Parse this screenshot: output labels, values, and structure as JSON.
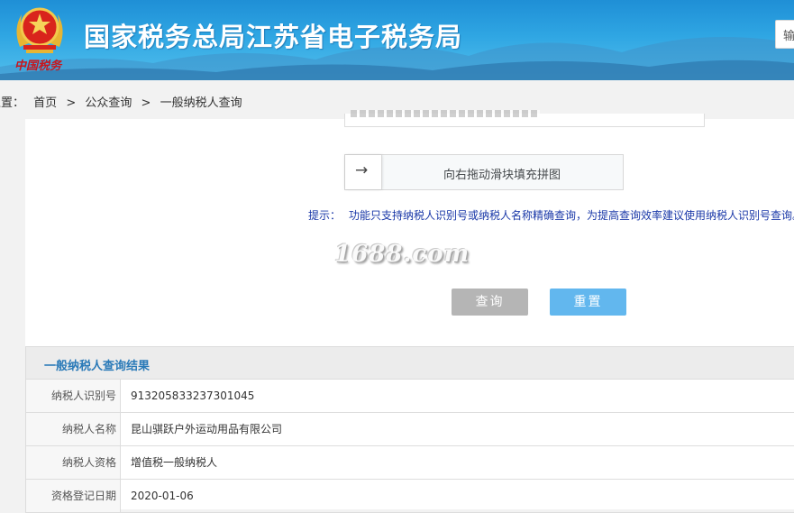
{
  "header": {
    "title": "国家税务总局江苏省电子税务局",
    "brand_script": "中国税务",
    "login_partial": "输"
  },
  "breadcrumb": {
    "prefix": "位置：",
    "items": [
      "首页",
      ">",
      "公众查询",
      ">",
      "一般纳税人查询"
    ]
  },
  "query": {
    "slider_text": "向右拖动滑块填充拼图",
    "slider_arrow": "→",
    "tip_label": "提示：",
    "tip_text": "功能只支持纳税人识别号或纳税人名称精确查询，为提高查询效率建议使用纳税人识别号查询。",
    "watermark": "1688.com",
    "query_button": "查询",
    "reset_button": "重置"
  },
  "result": {
    "title": "一般纳税人查询结果",
    "rows": [
      {
        "label": "纳税人识别号",
        "value": "913205833237301045"
      },
      {
        "label": "纳税人名称",
        "value": "昆山骐跃户外运动用品有限公司"
      },
      {
        "label": "纳税人资格",
        "value": "增值税一般纳税人"
      },
      {
        "label": "资格登记日期",
        "value": "2020-01-06"
      }
    ]
  },
  "colors": {
    "header_blue": "#2fa6e3",
    "tip_blue": "#1a38a8",
    "reset_blue": "#62b7ee",
    "query_gray": "#b5b5b5",
    "result_title": "#2a7ab8"
  }
}
